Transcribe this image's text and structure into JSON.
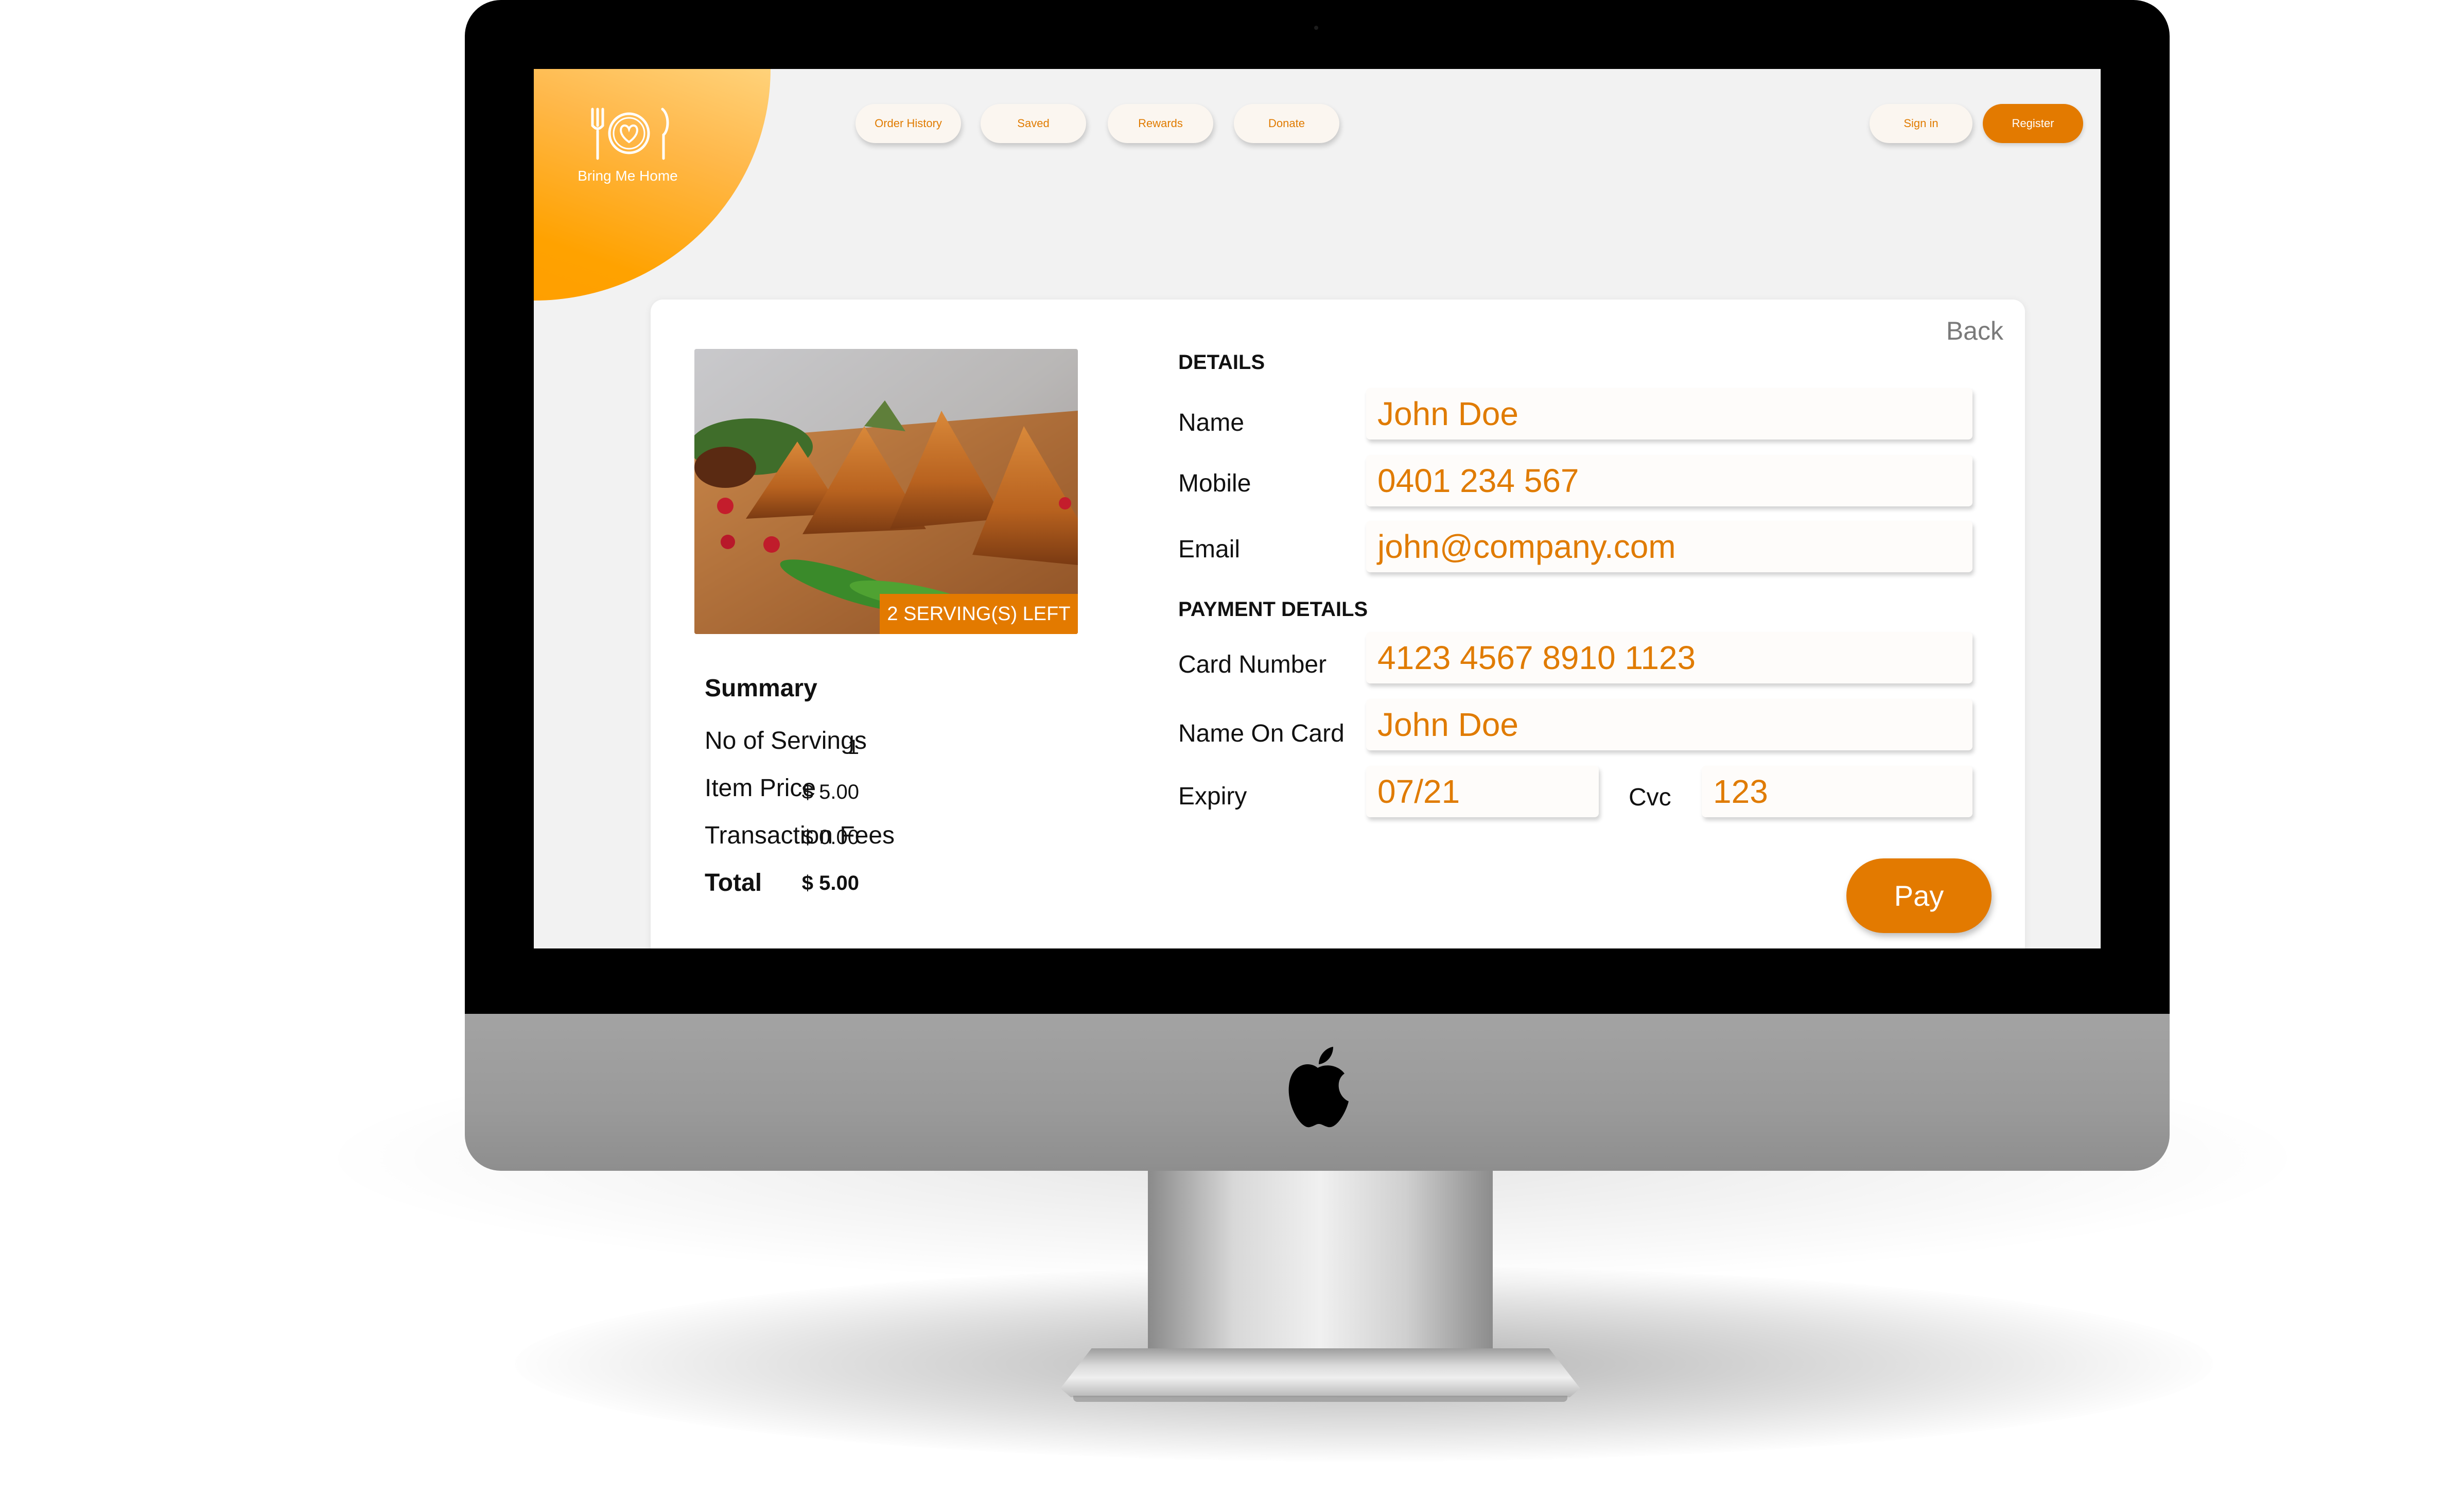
{
  "brand": {
    "name": "Bring Me Home"
  },
  "nav": {
    "items": [
      {
        "label": "Order History"
      },
      {
        "label": "Saved"
      },
      {
        "label": "Rewards"
      },
      {
        "label": "Donate"
      }
    ],
    "sign_in": "Sign in",
    "register": "Register"
  },
  "card": {
    "back": "Back",
    "servings_left": "2 SERVING(S) LEFT",
    "summary": {
      "title": "Summary",
      "rows": [
        {
          "label": "No of Servings",
          "value": "1"
        },
        {
          "label": "Item Price",
          "value": "$ 5.00"
        },
        {
          "label": "Transaction Fees",
          "value": "$ 0.00"
        },
        {
          "label": "Total",
          "value": "$ 5.00"
        }
      ]
    },
    "details": {
      "title": "DETAILS",
      "name_label": "Name",
      "name_value": "John Doe",
      "mobile_label": "Mobile",
      "mobile_value": "0401 234 567",
      "email_label": "Email",
      "email_value": "john@company.com"
    },
    "payment": {
      "title": "PAYMENT DETAILS",
      "card_number_label": "Card Number",
      "card_number_value": "4123 4567 8910 1123",
      "name_on_card_label": "Name On Card",
      "name_on_card_value": "John Doe",
      "expiry_label": "Expiry",
      "expiry_value": "07/21",
      "cvc_label": "Cvc",
      "cvc_value": "123"
    },
    "pay": "Pay"
  },
  "colors": {
    "accent": "#e37a00",
    "logo_gradient_start": "#ffd27a",
    "logo_gradient_end": "#ffa200",
    "screen_bg": "#f2f2f2"
  },
  "icons": [
    "plate-heart-icon",
    "fork-icon",
    "knife-icon",
    "apple-logo-icon"
  ]
}
